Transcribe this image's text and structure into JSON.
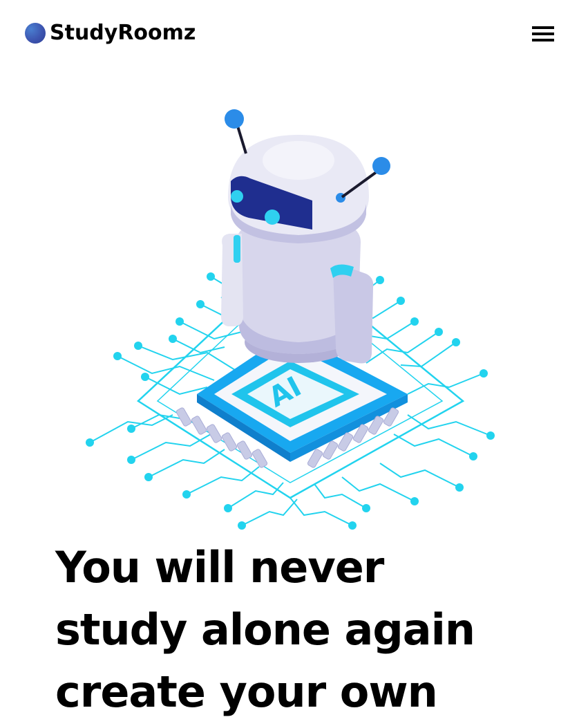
{
  "header": {
    "brand_name": "StudyRoomz",
    "brand_color": "#3d55b0",
    "menu_icon": "hamburger-menu-icon"
  },
  "hero": {
    "illustration": "ai-robot-on-chip-illustration",
    "illustration_label": "AI",
    "title_lines": [
      "You will never",
      "study alone again",
      "create your own"
    ]
  },
  "colors": {
    "circuit": "#22d3ee",
    "chip_blue": "#18a8f0",
    "robot_body": "#dcdcee",
    "visor": "#1f2e8f",
    "antenna_tip": "#2b8ce8"
  }
}
